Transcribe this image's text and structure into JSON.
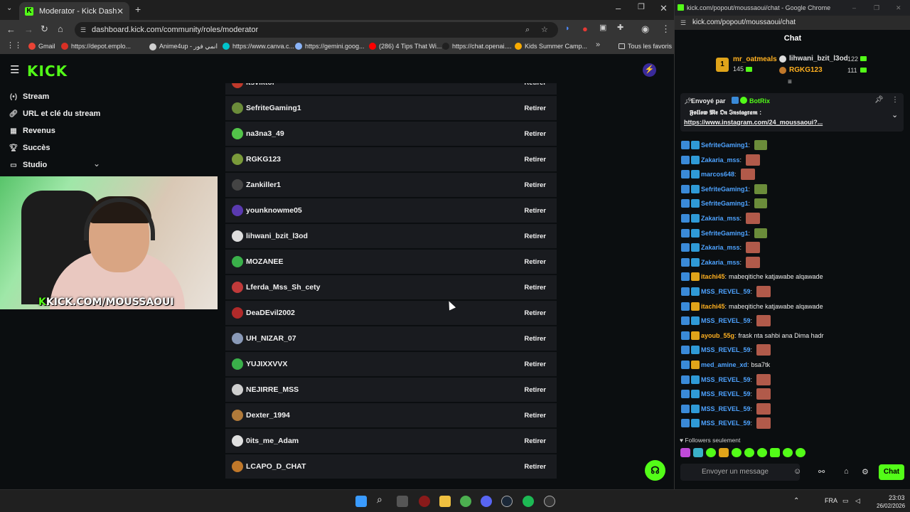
{
  "browser": {
    "tab_title": "Moderator - Kick Dashboard",
    "url": "dashboard.kick.com/community/roles/moderator",
    "bookmarks": [
      {
        "label": "Gmail",
        "color": "#ea4335"
      },
      {
        "label": "https://depot.emplo...",
        "color": "#d93025"
      },
      {
        "label": "Anime4up - انمي فور",
        "color": "#cfcfcf"
      },
      {
        "label": "https://www.canva.c...",
        "color": "#00c4cc"
      },
      {
        "label": "https://gemini.goog...",
        "color": "#8ab4f8"
      },
      {
        "label": "(286) 4 Tips That Wi...",
        "color": "#ff0000"
      },
      {
        "label": "https://chat.openai....",
        "color": "#202020"
      },
      {
        "label": "Kids Summer Camp...",
        "color": "#f9ab00"
      }
    ],
    "all_bookmarks": "Tous les favoris"
  },
  "kick": {
    "logo": "KICK",
    "sidebar": [
      {
        "label": "Stream",
        "icon": "stream-icon"
      },
      {
        "label": "URL et clé du stream",
        "icon": "link-icon"
      },
      {
        "label": "Revenus",
        "icon": "revenue-icon"
      },
      {
        "label": "Succès",
        "icon": "trophy-icon"
      },
      {
        "label": "Studio",
        "icon": "studio-icon"
      }
    ],
    "webcam_banner_prefix": "K",
    "webcam_banner": "KICK.COM/MOUSSAOUI",
    "remove_label": "Retirer",
    "moderators": [
      {
        "name": "itsviktor",
        "color": "#c0392b"
      },
      {
        "name": "SefriteGaming1",
        "color": "#6b8c3a"
      },
      {
        "name": "na3na3_49",
        "color": "#53c44a"
      },
      {
        "name": "RGKG123",
        "color": "#7a9a3a"
      },
      {
        "name": "Zankiller1",
        "color": "#444"
      },
      {
        "name": "younknowme05",
        "color": "#5a3ab0"
      },
      {
        "name": "lihwani_bzit_l3od",
        "color": "#ddd"
      },
      {
        "name": "MOZANEE",
        "color": "#3ab04a"
      },
      {
        "name": "Lferda_Mss_Sh_cety",
        "color": "#c03a3a"
      },
      {
        "name": "DeaDEvil2002",
        "color": "#b02a2a"
      },
      {
        "name": "UH_NIZAR_07",
        "color": "#8a9ab8"
      },
      {
        "name": "YUJIXXVVX",
        "color": "#3ab04a"
      },
      {
        "name": "NEJIRRE_MSS",
        "color": "#cfcfcf"
      },
      {
        "name": "Dexter_1994",
        "color": "#b07a3a"
      },
      {
        "name": "0its_me_Adam",
        "color": "#e0e0e0"
      },
      {
        "name": "LCAPO_D_CHAT",
        "color": "#c0782a"
      }
    ]
  },
  "popout": {
    "window_title": "kick.com/popout/moussaoui/chat - Google Chrome",
    "url": "kick.com/popout/moussaoui/chat",
    "chat_title": "Chat",
    "leaderboard": [
      {
        "rank": "1",
        "name": "mr_oatmeals",
        "value": "145"
      },
      {
        "rank": "",
        "name": "lihwani_bzit_l3od",
        "value": "122"
      },
      {
        "rank": "",
        "name": "RGKG123",
        "value": "111"
      }
    ],
    "pinned": {
      "sent_by_label": "Envoyé par",
      "sender": "BotRix",
      "text": "𝕱𝖔𝖑𝖑𝖔𝖜 𝕸𝖊 𝕺𝖓 𝕴𝖓𝖘𝖙𝖆𝖌𝖗𝖆𝖒 :",
      "link": "https://www.instagram.com/24_moussaoui?..."
    },
    "messages": [
      {
        "user": "SefriteGaming1",
        "color": "#4ea3ff",
        "text": "",
        "emote": "tank"
      },
      {
        "user": "Zakaria_mss",
        "color": "#4ea3ff",
        "text": "",
        "emote": "face"
      },
      {
        "user": "marcos648",
        "color": "#4ea3ff",
        "text": "",
        "emote": "face"
      },
      {
        "user": "SefriteGaming1",
        "color": "#4ea3ff",
        "text": "",
        "emote": "tank"
      },
      {
        "user": "SefriteGaming1",
        "color": "#4ea3ff",
        "text": "",
        "emote": "tank"
      },
      {
        "user": "Zakaria_mss",
        "color": "#4ea3ff",
        "text": "",
        "emote": "face"
      },
      {
        "user": "SefriteGaming1",
        "color": "#4ea3ff",
        "text": "",
        "emote": "tank"
      },
      {
        "user": "Zakaria_mss",
        "color": "#4ea3ff",
        "text": "",
        "emote": "face"
      },
      {
        "user": "Zakaria_mss",
        "color": "#4ea3ff",
        "text": "",
        "emote": "face"
      },
      {
        "user": "itachi45",
        "color": "#ffb020",
        "text": "mabeqitiche katjawabe alqawade",
        "emote": ""
      },
      {
        "user": "MSS_REVEL_59",
        "color": "#4ea3ff",
        "text": "",
        "emote": "face"
      },
      {
        "user": "itachi45",
        "color": "#ffb020",
        "text": "mabeqitiche katjawabe alqawade",
        "emote": ""
      },
      {
        "user": "MSS_REVEL_59",
        "color": "#4ea3ff",
        "text": "",
        "emote": "face"
      },
      {
        "user": "ayoub_55g",
        "color": "#ffb020",
        "text": "frask nta sahbi ana Dima hadr",
        "emote": ""
      },
      {
        "user": "MSS_REVEL_59",
        "color": "#4ea3ff",
        "text": "",
        "emote": "face"
      },
      {
        "user": "med_amine_xd",
        "color": "#4ea3ff",
        "text": "bsa7tk",
        "emote": ""
      },
      {
        "user": "MSS_REVEL_59",
        "color": "#4ea3ff",
        "text": "",
        "emote": "face"
      },
      {
        "user": "MSS_REVEL_59",
        "color": "#4ea3ff",
        "text": "",
        "emote": "face"
      },
      {
        "user": "MSS_REVEL_59",
        "color": "#4ea3ff",
        "text": "",
        "emote": "face"
      },
      {
        "user": "MSS_REVEL_59",
        "color": "#4ea3ff",
        "text": "",
        "emote": "face"
      }
    ],
    "followers_only": "Followers seulement",
    "input_placeholder": "Envoyer un message",
    "chat_button": "Chat"
  },
  "taskbar": {
    "lang": "FRA",
    "time": "23:03",
    "date": "26/02/2026"
  }
}
